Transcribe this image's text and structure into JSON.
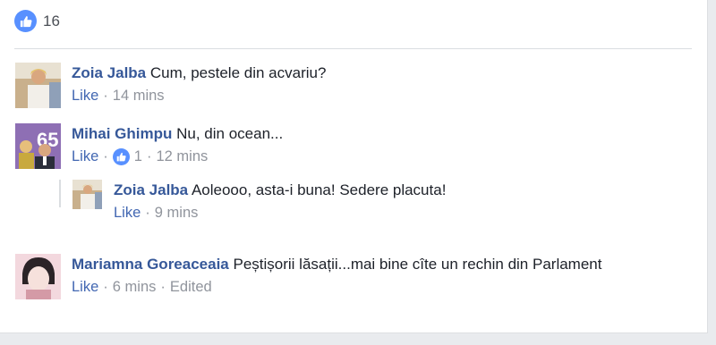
{
  "reactions": {
    "count": "16",
    "icon": "like-icon",
    "color": "#5890ff"
  },
  "comments": [
    {
      "author": "Zoia Jalba",
      "text": "Cum, pestele din acvariu?",
      "like": "Like",
      "time": "14 mins"
    },
    {
      "author": "Mihai Ghimpu",
      "text": "Nu, din ocean...",
      "like": "Like",
      "reaction_count": "1",
      "time": "12 mins"
    },
    {
      "author": "Zoia Jalba",
      "text": "Aoleooo, asta-i buna! Sedere placuta!",
      "like": "Like",
      "time": "9 mins"
    },
    {
      "author": "Mariamna Goreaceaia",
      "text": "Peștișorii lăsații...mai bine cîte un rechin din Parlament",
      "like": "Like",
      "time": "6 mins",
      "edited": "Edited"
    }
  ],
  "separator": "·"
}
